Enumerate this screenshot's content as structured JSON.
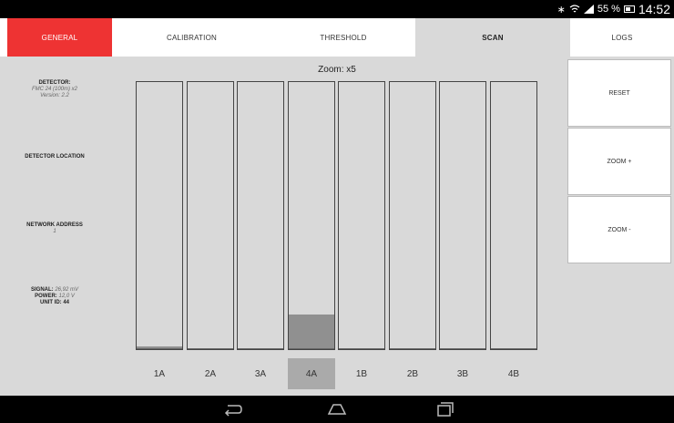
{
  "status": {
    "icons": [
      "bluetooth-icon",
      "wifi-icon",
      "signal-icon",
      "battery-icon"
    ],
    "battery_percent": "55 %",
    "battery_level": 0.55,
    "time": "14:52"
  },
  "tabs": {
    "general": "GENERAL",
    "calibration": "CALIBRATION",
    "threshold": "THRESHOLD",
    "scan": "SCAN",
    "logs": "LOGS",
    "active": "SCAN",
    "accent": "#ee3333"
  },
  "info": {
    "detector_heading": "DETECTOR:",
    "detector_model": "FMC 24 (100m) x2",
    "detector_version": "Version: 2.2",
    "location_heading": "DETECTOR LOCATION",
    "network_heading": "NETWORK ADDRESS",
    "network_value": "1",
    "signal_label": "SIGNAL:",
    "signal_value": "26,92 mV",
    "power_label": "POWER:",
    "power_value": "12,0 V",
    "unit_label": "UNIT ID:",
    "unit_value": "44"
  },
  "scan": {
    "zoom_label": "Zoom: x5",
    "selected": "4A",
    "channels": [
      {
        "label": "1A",
        "level": 0.01
      },
      {
        "label": "2A",
        "level": 0.0
      },
      {
        "label": "3A",
        "level": 0.0
      },
      {
        "label": "4A",
        "level": 0.13
      },
      {
        "label": "1B",
        "level": 0.0
      },
      {
        "label": "2B",
        "level": 0.0
      },
      {
        "label": "3B",
        "level": 0.0
      },
      {
        "label": "4B",
        "level": 0.0
      }
    ]
  },
  "buttons": {
    "reset": "RESET",
    "zoom_in": "ZOOM +",
    "zoom_out": "ZOOM -"
  },
  "nav": {
    "icons": [
      "back-icon",
      "home-icon",
      "recent-apps-icon"
    ]
  }
}
